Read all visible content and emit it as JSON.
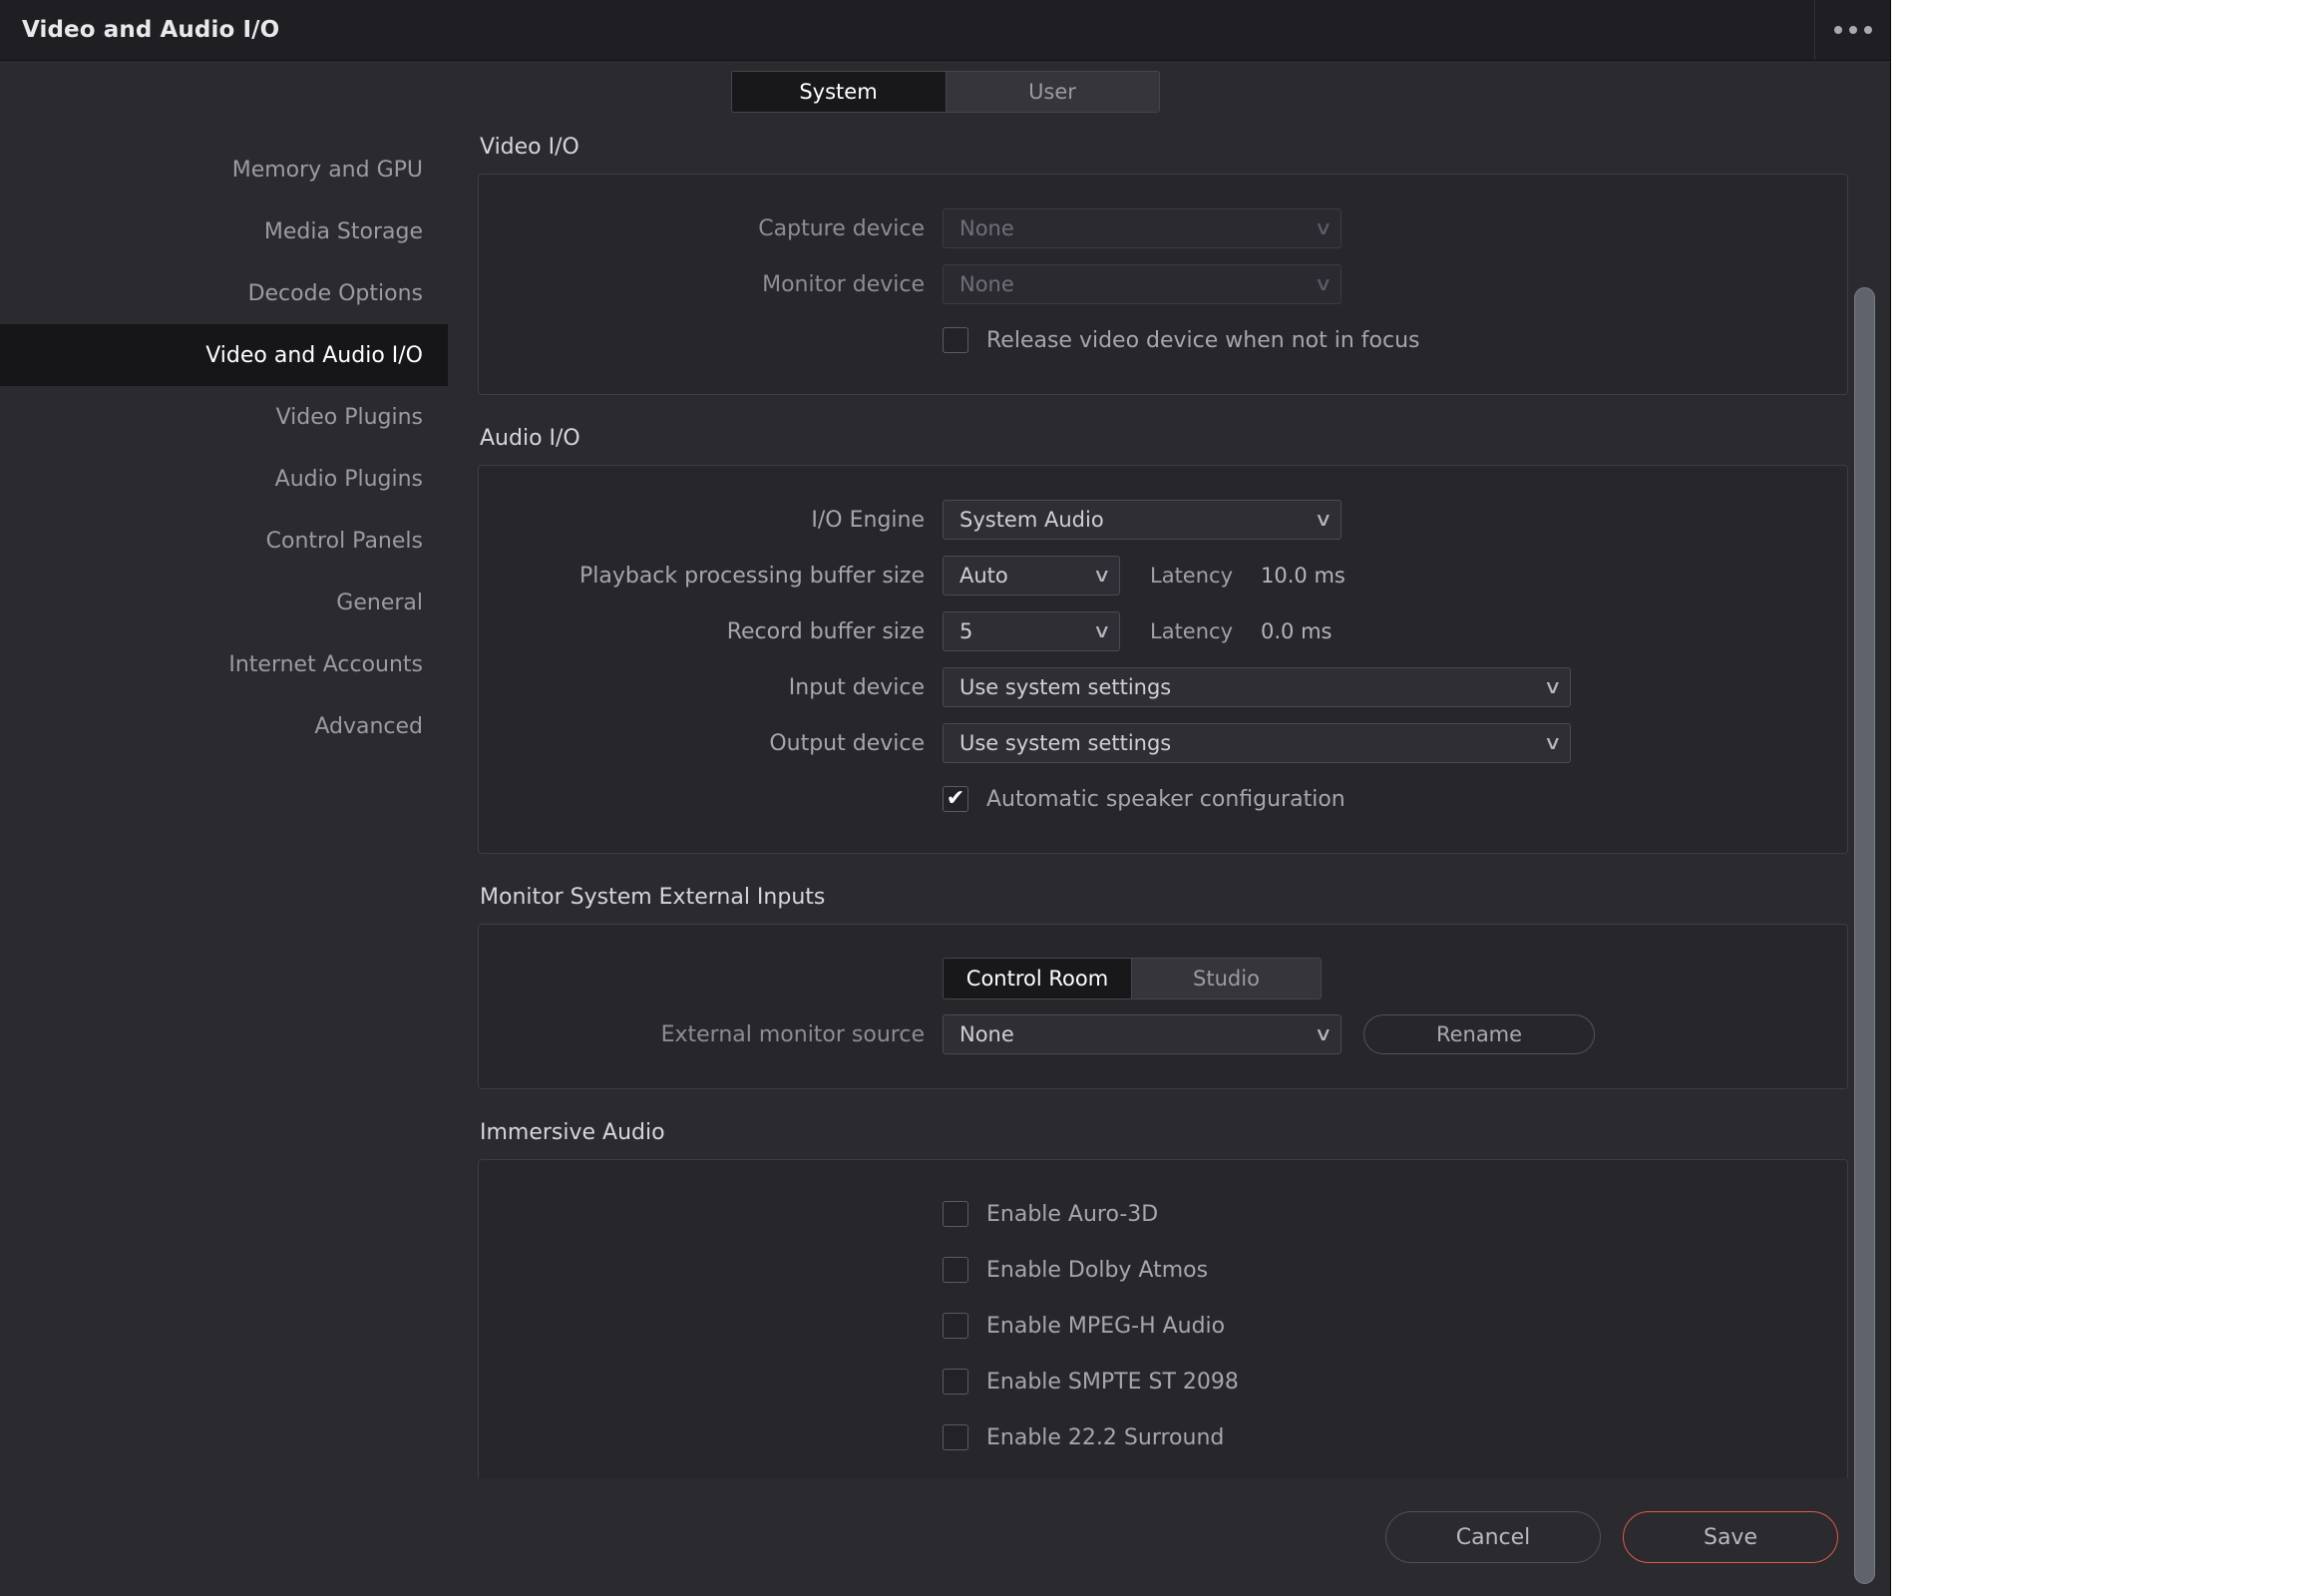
{
  "window": {
    "title": "Video and Audio I/O",
    "menu_icon": "overflow-menu-icon"
  },
  "tabs": {
    "system": "System",
    "user": "User",
    "active": "System"
  },
  "sidebar": {
    "items": [
      {
        "label": "Memory and GPU",
        "active": false
      },
      {
        "label": "Media Storage",
        "active": false
      },
      {
        "label": "Decode Options",
        "active": false
      },
      {
        "label": "Video and Audio I/O",
        "active": true
      },
      {
        "label": "Video Plugins",
        "active": false
      },
      {
        "label": "Audio Plugins",
        "active": false
      },
      {
        "label": "Control Panels",
        "active": false
      },
      {
        "label": "General",
        "active": false
      },
      {
        "label": "Internet Accounts",
        "active": false
      },
      {
        "label": "Advanced",
        "active": false
      }
    ]
  },
  "video_io": {
    "title": "Video I/O",
    "capture_device": {
      "label": "Capture device",
      "value": "None"
    },
    "monitor_device": {
      "label": "Monitor device",
      "value": "None"
    },
    "release_video_device": {
      "label": "Release video device when not in focus",
      "checked": false
    }
  },
  "audio_io": {
    "title": "Audio I/O",
    "io_engine": {
      "label": "I/O Engine",
      "value": "System Audio"
    },
    "playback_buffer": {
      "label": "Playback processing buffer size",
      "value": "Auto",
      "latency_label": "Latency",
      "latency_value": "10.0 ms"
    },
    "record_buffer": {
      "label": "Record buffer size",
      "value": "5",
      "latency_label": "Latency",
      "latency_value": "0.0 ms"
    },
    "input_device": {
      "label": "Input device",
      "value": "Use system settings"
    },
    "output_device": {
      "label": "Output device",
      "value": "Use system settings"
    },
    "auto_speaker": {
      "label": "Automatic speaker configuration",
      "checked": true
    }
  },
  "monitor_external": {
    "title": "Monitor System External Inputs",
    "seg_control_room": "Control Room",
    "seg_studio": "Studio",
    "seg_active": "Control Room",
    "external_monitor_source": {
      "label": "External monitor source",
      "value": "None"
    },
    "rename_button": "Rename"
  },
  "immersive_audio": {
    "title": "Immersive Audio",
    "options": [
      {
        "label": "Enable Auro-3D",
        "checked": false
      },
      {
        "label": "Enable Dolby Atmos",
        "checked": false
      },
      {
        "label": "Enable MPEG-H Audio",
        "checked": false
      },
      {
        "label": "Enable SMPTE ST 2098",
        "checked": false
      },
      {
        "label": "Enable 22.2 Surround",
        "checked": false
      }
    ]
  },
  "footer": {
    "cancel": "Cancel",
    "save": "Save",
    "save_accent_color": "#e05c4b"
  },
  "glyphs": {
    "chevron_down": "∨",
    "checkmark": "✔"
  }
}
